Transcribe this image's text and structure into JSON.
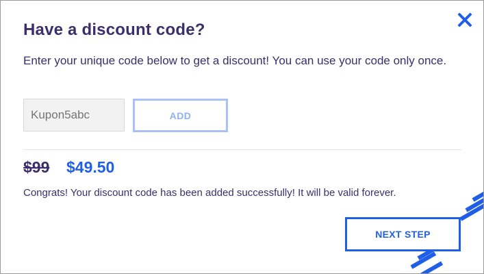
{
  "modal": {
    "title": "Have a discount code?",
    "description": "Enter your unique code below to get a discount! You can use your code only once.",
    "code_input": {
      "value": "",
      "placeholder": "Kupon5abc"
    },
    "add_label": "ADD",
    "price": {
      "old": "$99",
      "new": "$49.50"
    },
    "success_message": "Congrats! Your discount code has been added successfully! It will be valid forever.",
    "next_label": "NEXT STEP"
  },
  "colors": {
    "accent": "#1f5fe6",
    "heading": "#3a2e6b",
    "add_border": "#a9c0f5"
  },
  "icons": {
    "close": "close-icon"
  }
}
